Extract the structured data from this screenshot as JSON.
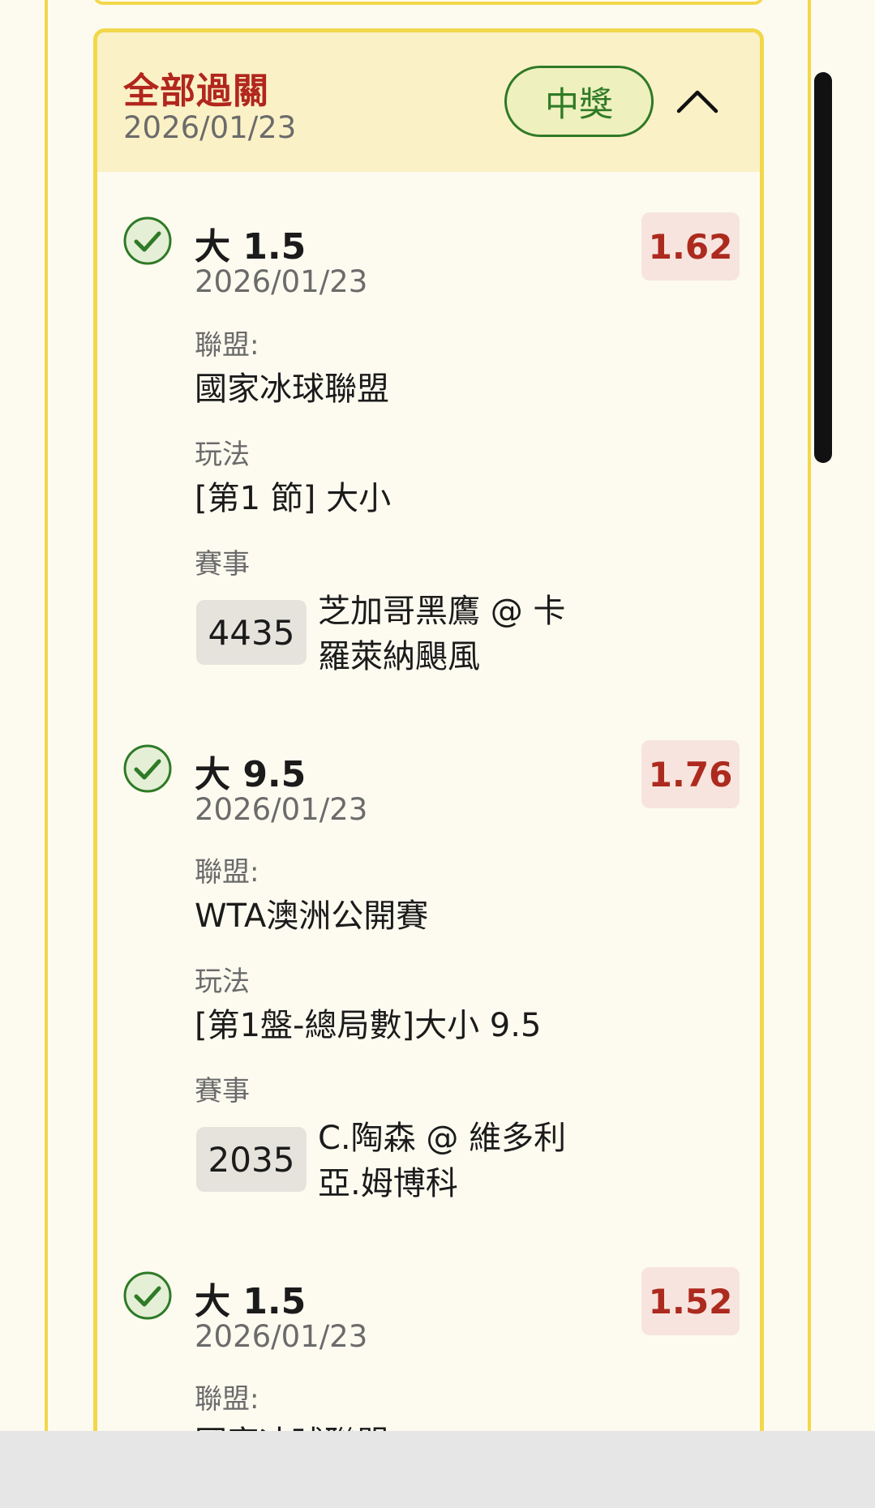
{
  "card": {
    "title": "全部過關",
    "date": "2026/01/23",
    "status": "中獎"
  },
  "labels": {
    "league": "聯盟:",
    "play": "玩法",
    "event": "賽事"
  },
  "bets": [
    {
      "selection": "大 1.5",
      "date": "2026/01/23",
      "odds": "1.62",
      "league": "國家冰球聯盟",
      "play": "[第1 節] 大小",
      "event_id": "4435",
      "event_name": "芝加哥黑鷹 @ 卡羅萊納颶風"
    },
    {
      "selection": "大 9.5",
      "date": "2026/01/23",
      "odds": "1.76",
      "league": "WTA澳洲公開賽",
      "play": "[第1盤-總局數]大小 9.5",
      "event_id": "2035",
      "event_name": "C.陶森 @ 維多利亞.姆博科"
    },
    {
      "selection": "大 1.5",
      "date": "2026/01/23",
      "odds": "1.52",
      "league": "國家冰球聯盟"
    }
  ],
  "icons": {
    "check": "check-circle-icon",
    "collapse": "chevron-up-icon"
  },
  "colors": {
    "accent_border": "#f2d74a",
    "title_red": "#b1261d",
    "win_green": "#2f7a26",
    "odds_bg": "#f7e4de"
  }
}
